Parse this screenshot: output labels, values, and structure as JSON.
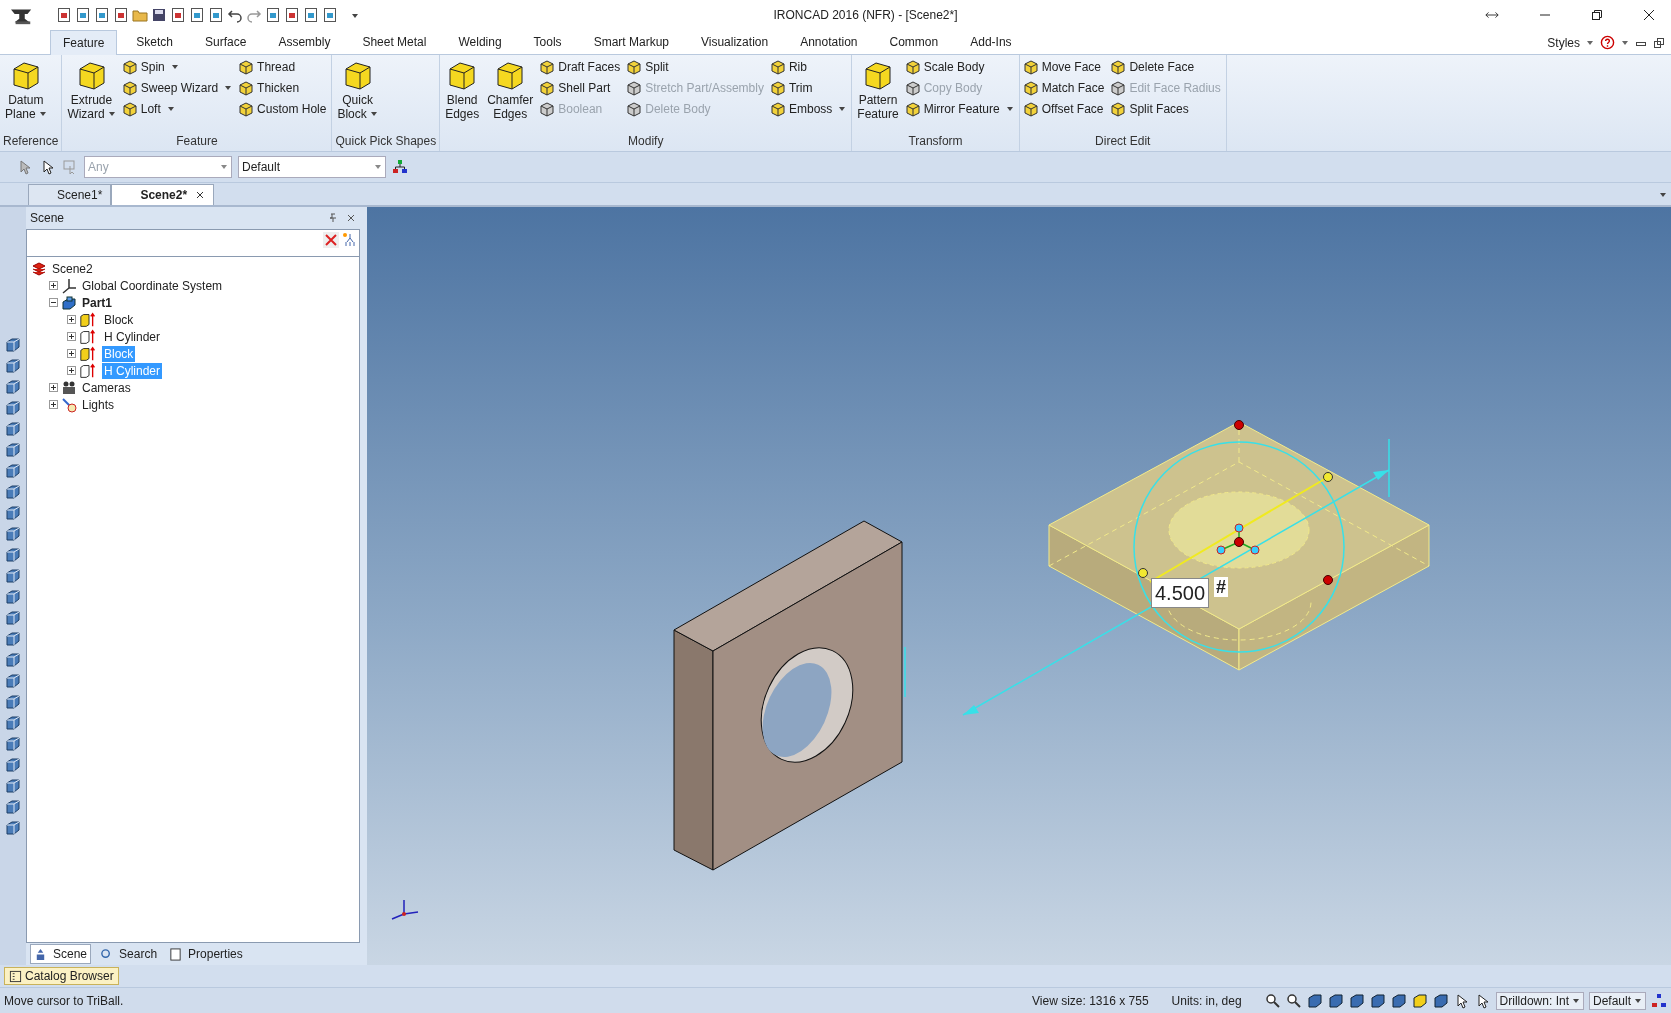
{
  "window": {
    "title": "IRONCAD 2016 (NFR) - [Scene2*]"
  },
  "ribbon_tabs": [
    {
      "label": "Feature",
      "selected": true
    },
    {
      "label": "Sketch",
      "selected": false
    },
    {
      "label": "Surface",
      "selected": false
    },
    {
      "label": "Assembly",
      "selected": false
    },
    {
      "label": "Sheet Metal",
      "selected": false
    },
    {
      "label": "Welding",
      "selected": false
    },
    {
      "label": "Tools",
      "selected": false
    },
    {
      "label": "Smart Markup",
      "selected": false
    },
    {
      "label": "Visualization",
      "selected": false
    },
    {
      "label": "Annotation",
      "selected": false
    },
    {
      "label": "Common",
      "selected": false
    },
    {
      "label": "Add-Ins",
      "selected": false
    }
  ],
  "ribbon_right": {
    "label": "Styles"
  },
  "ribbon_groups": [
    {
      "label": "Reference",
      "items": [
        {
          "kind": "large",
          "lines": [
            "Datum",
            "Plane"
          ],
          "dropdown": true,
          "disabled": false
        }
      ]
    },
    {
      "label": "Feature",
      "items": [
        {
          "kind": "large",
          "lines": [
            "Extrude",
            "Wizard"
          ],
          "dropdown": true,
          "disabled": false
        },
        {
          "kind": "small",
          "label": "Spin",
          "dropdown": true,
          "disabled": false
        },
        {
          "kind": "small",
          "label": "Sweep Wizard",
          "dropdown": true,
          "disabled": false
        },
        {
          "kind": "small",
          "label": "Loft",
          "dropdown": true,
          "disabled": false
        },
        {
          "kind": "small",
          "label": "Thread",
          "dropdown": false,
          "disabled": false
        },
        {
          "kind": "small",
          "label": "Thicken",
          "dropdown": false,
          "disabled": false
        },
        {
          "kind": "small",
          "label": "Custom Hole",
          "dropdown": false,
          "disabled": false
        }
      ]
    },
    {
      "label": "Quick Pick Shapes",
      "items": [
        {
          "kind": "large",
          "lines": [
            "Quick",
            "Block"
          ],
          "dropdown": true,
          "disabled": false
        }
      ]
    },
    {
      "label": "Modify",
      "items": [
        {
          "kind": "large",
          "lines": [
            "Blend",
            "Edges"
          ],
          "dropdown": false,
          "disabled": false
        },
        {
          "kind": "large",
          "lines": [
            "Chamfer",
            "Edges"
          ],
          "dropdown": false,
          "disabled": false
        },
        {
          "kind": "small",
          "label": "Draft Faces",
          "dropdown": false,
          "disabled": false
        },
        {
          "kind": "small",
          "label": "Shell Part",
          "dropdown": false,
          "disabled": false
        },
        {
          "kind": "small",
          "label": "Boolean",
          "dropdown": false,
          "disabled": true
        },
        {
          "kind": "small",
          "label": "Split",
          "dropdown": false,
          "disabled": false
        },
        {
          "kind": "small",
          "label": "Stretch Part/Assembly",
          "dropdown": false,
          "disabled": true
        },
        {
          "kind": "small",
          "label": "Delete Body",
          "dropdown": false,
          "disabled": true
        },
        {
          "kind": "small",
          "label": "Rib",
          "dropdown": false,
          "disabled": false
        },
        {
          "kind": "small",
          "label": "Trim",
          "dropdown": false,
          "disabled": false
        },
        {
          "kind": "small",
          "label": "Emboss",
          "dropdown": true,
          "disabled": false
        }
      ]
    },
    {
      "label": "Transform",
      "items": [
        {
          "kind": "large",
          "lines": [
            "Pattern",
            "Feature"
          ],
          "dropdown": false,
          "disabled": false
        },
        {
          "kind": "small",
          "label": "Scale Body",
          "dropdown": false,
          "disabled": false
        },
        {
          "kind": "small",
          "label": "Copy Body",
          "dropdown": false,
          "disabled": true
        },
        {
          "kind": "small",
          "label": "Mirror Feature",
          "dropdown": true,
          "disabled": false
        }
      ]
    },
    {
      "label": "Direct Edit",
      "items": [
        {
          "kind": "small",
          "label": "Move Face",
          "dropdown": false,
          "disabled": false
        },
        {
          "kind": "small",
          "label": "Match Face",
          "dropdown": false,
          "disabled": false
        },
        {
          "kind": "small",
          "label": "Offset Face",
          "dropdown": false,
          "disabled": false
        },
        {
          "kind": "small",
          "label": "Delete Face",
          "dropdown": false,
          "disabled": false
        },
        {
          "kind": "small",
          "label": "Edit Face Radius",
          "dropdown": false,
          "disabled": true
        },
        {
          "kind": "small",
          "label": "Split Faces",
          "dropdown": false,
          "disabled": false
        }
      ]
    }
  ],
  "selection_toolbar": {
    "filter": {
      "value": "Any",
      "disabled": true
    },
    "style": {
      "value": "Default",
      "disabled": false
    }
  },
  "document_tabs": [
    {
      "label": "Scene1*",
      "selected": false
    },
    {
      "label": "Scene2*",
      "selected": true
    }
  ],
  "scene_panel": {
    "title": "Scene",
    "tree": [
      {
        "label": "Scene2",
        "kind": "scene",
        "selected": false,
        "children": [
          {
            "label": "Global Coordinate System",
            "kind": "axes",
            "selected": false,
            "expanded": false
          },
          {
            "label": "Part1",
            "kind": "part",
            "selected": false,
            "expanded": true,
            "children": [
              {
                "label": "Block",
                "kind": "block",
                "selected": false,
                "expanded": false
              },
              {
                "label": "H Cylinder",
                "kind": "cylinder",
                "selected": false,
                "expanded": false
              },
              {
                "label": "Block",
                "kind": "block",
                "selected": true,
                "expanded": false
              },
              {
                "label": "H Cylinder",
                "kind": "cylinder",
                "selected": true,
                "expanded": false
              }
            ]
          },
          {
            "label": "Cameras",
            "kind": "camera",
            "selected": false,
            "expanded": false
          },
          {
            "label": "Lights",
            "kind": "light",
            "selected": false,
            "expanded": false
          }
        ]
      }
    ],
    "tabs": [
      {
        "label": "Scene",
        "selected": true
      },
      {
        "label": "Search",
        "selected": false
      },
      {
        "label": "Properties",
        "selected": false
      }
    ]
  },
  "catalog_button": "Catalog Browser",
  "viewport": {
    "dimension_value": "4.500",
    "dimension_suffix": "#"
  },
  "status_bar": {
    "message": "Move cursor to TriBall.",
    "view_size": "View size: 1316 x  755",
    "units": "Units: in, deg",
    "drilldown": "Drilldown: Int",
    "style": "Default"
  }
}
